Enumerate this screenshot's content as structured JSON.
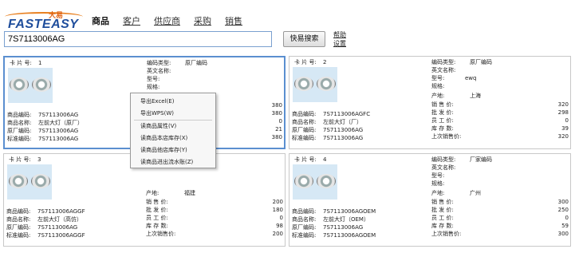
{
  "logo": {
    "brand": "FASTEASY",
    "cn": "大易"
  },
  "nav": {
    "items": [
      "商品",
      "客户",
      "供应商",
      "采购",
      "销售"
    ]
  },
  "search": {
    "value": "7S7113006AG",
    "button": "快易搜索",
    "help": "帮助",
    "settings": "设置"
  },
  "cards": [
    {
      "card_no_label": "卡 片 号:",
      "card_no": "1",
      "code_label": "商品编码:",
      "code": "7S7113006AG",
      "name_label": "商品名称:",
      "name": "左前大灯（原厂）",
      "factory_label": "原厂编码:",
      "factory": "7S7113006AG",
      "std_label": "标准编码:",
      "std": "7S7113006AG",
      "type_label": "编码类型:",
      "type": "原厂编码",
      "en_label": "英文名称:",
      "en": "",
      "model_label": "型号:",
      "model": "",
      "spec_label": "规格:",
      "spec": "",
      "origin_label": "",
      "origin": "",
      "price_label": "",
      "price": "380",
      "wholesale_label": "",
      "wholesale": "380",
      "staff_label": "",
      "staff": "0",
      "stock_label": "",
      "stock": "21",
      "last_label": "",
      "last": "380"
    },
    {
      "card_no_label": "卡 片 号:",
      "card_no": "2",
      "code_label": "商品编码:",
      "code": "7S7113006AGFC",
      "name_label": "商品名称:",
      "name": "左前大灯（厂）",
      "factory_label": "原厂编码:",
      "factory": "7S7113006AG",
      "std_label": "标准编码:",
      "std": "7S7113006AG",
      "type_label": "编码类型:",
      "type": "原厂编码",
      "en_label": "英文名称:",
      "en": "",
      "model_label": "型号:",
      "model": "ewq",
      "spec_label": "规格:",
      "spec": "",
      "origin_label": "产地:",
      "origin": "上海",
      "price_label": "销 售 价:",
      "price": "320",
      "wholesale_label": "批 发 价:",
      "wholesale": "298",
      "staff_label": "员 工 价:",
      "staff": "0",
      "stock_label": "库 存 数:",
      "stock": "39",
      "last_label": "上次销售价:",
      "last": "320"
    },
    {
      "card_no_label": "卡 片 号:",
      "card_no": "3",
      "code_label": "商品编码:",
      "code": "7S7113006AGGF",
      "name_label": "商品名称:",
      "name": "左前大灯（高仿）",
      "factory_label": "原厂编码:",
      "factory": "7S7113006AG",
      "std_label": "标准编码:",
      "std": "7S7113006AGGF",
      "type_label": "",
      "type": "",
      "en_label": "",
      "en": "",
      "model_label": "",
      "model": "",
      "spec_label": "",
      "spec": "",
      "origin_label": "产地:",
      "origin": "福建",
      "price_label": "销 售 价:",
      "price": "200",
      "wholesale_label": "批 发 价:",
      "wholesale": "180",
      "staff_label": "员 工 价:",
      "staff": "0",
      "stock_label": "库 存 数:",
      "stock": "98",
      "last_label": "上次销售价:",
      "last": "200"
    },
    {
      "card_no_label": "卡 片 号:",
      "card_no": "4",
      "code_label": "商品编码:",
      "code": "7S7113006AGOEM",
      "name_label": "商品名称:",
      "name": "左前大灯（OEM）",
      "factory_label": "原厂编码:",
      "factory": "7S7113006AG",
      "std_label": "标准编码:",
      "std": "7S7113006AGOEM",
      "type_label": "编码类型:",
      "type": "厂家编码",
      "en_label": "英文名称:",
      "en": "",
      "model_label": "型号:",
      "model": "",
      "spec_label": "规格:",
      "spec": "",
      "origin_label": "产地:",
      "origin": "广州",
      "price_label": "销 售 价:",
      "price": "300",
      "wholesale_label": "批 发 价:",
      "wholesale": "250",
      "staff_label": "员 工 价:",
      "staff": "0",
      "stock_label": "库 存 数:",
      "stock": "59",
      "last_label": "上次销售价:",
      "last": "300"
    }
  ],
  "context_menu": {
    "items": [
      "导出Excel(E)",
      "导出WPS(W)",
      "读商品属性(V)",
      "读商品本店库存(X)",
      "读商品他店库存(Y)",
      "读商品进出流水账(Z)"
    ]
  },
  "colors": {
    "accent": "#1f4e9c",
    "selected_border": "#5b8fd0",
    "thumb_bg": "#d6e8f5"
  }
}
